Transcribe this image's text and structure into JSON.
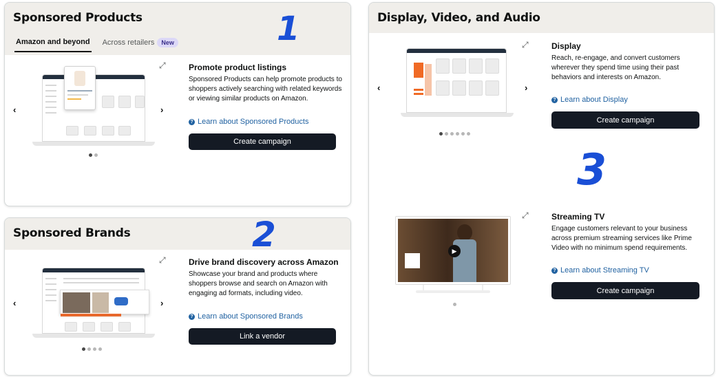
{
  "sponsored_products": {
    "title": "Sponsored Products",
    "tabs": [
      {
        "label": "Amazon and beyond",
        "active": true
      },
      {
        "label": "Across retailers",
        "badge": "New"
      }
    ],
    "section_title": "Promote product listings",
    "description": "Sponsored Products can help promote products to shoppers actively searching with related keywords or viewing similar products on Amazon.",
    "learn_link": "Learn about Sponsored Products",
    "button": "Create campaign",
    "carousel": {
      "count": 2,
      "active": 1
    }
  },
  "sponsored_brands": {
    "title": "Sponsored Brands",
    "section_title": "Drive brand discovery across Amazon",
    "description": "Showcase your brand and products where shoppers browse and search on Amazon with engaging ad formats, including video.",
    "learn_link": "Learn about Sponsored Brands",
    "button": "Link a vendor",
    "carousel": {
      "count": 4,
      "active": 1
    }
  },
  "display_video_audio": {
    "title": "Display, Video, and Audio",
    "display": {
      "section_title": "Display",
      "description": "Reach, re-engage, and convert customers wherever they spend time using their past behaviors and interests on Amazon.",
      "learn_link": "Learn about Display",
      "button": "Create campaign",
      "carousel": {
        "count": 6,
        "active": 1
      }
    },
    "streaming_tv": {
      "section_title": "Streaming TV",
      "description": "Engage customers relevant to your business across premium streaming services like Prime Video with no minimum spend requirements.",
      "learn_link": "Learn about Streaming TV",
      "button": "Create campaign",
      "carousel": {
        "count": 1,
        "active": 1
      }
    }
  },
  "annotations": [
    "1",
    "2",
    "3"
  ],
  "icons": {
    "prev": "chevron-left-icon",
    "next": "chevron-right-icon",
    "expand": "expand-icon",
    "help": "help-circle-icon"
  },
  "colors": {
    "header_bg": "#f0eeea",
    "button_bg": "#141a24",
    "link": "#2162a1",
    "annotation": "#1a4fd6",
    "badge_bg": "#dcd8f7"
  }
}
